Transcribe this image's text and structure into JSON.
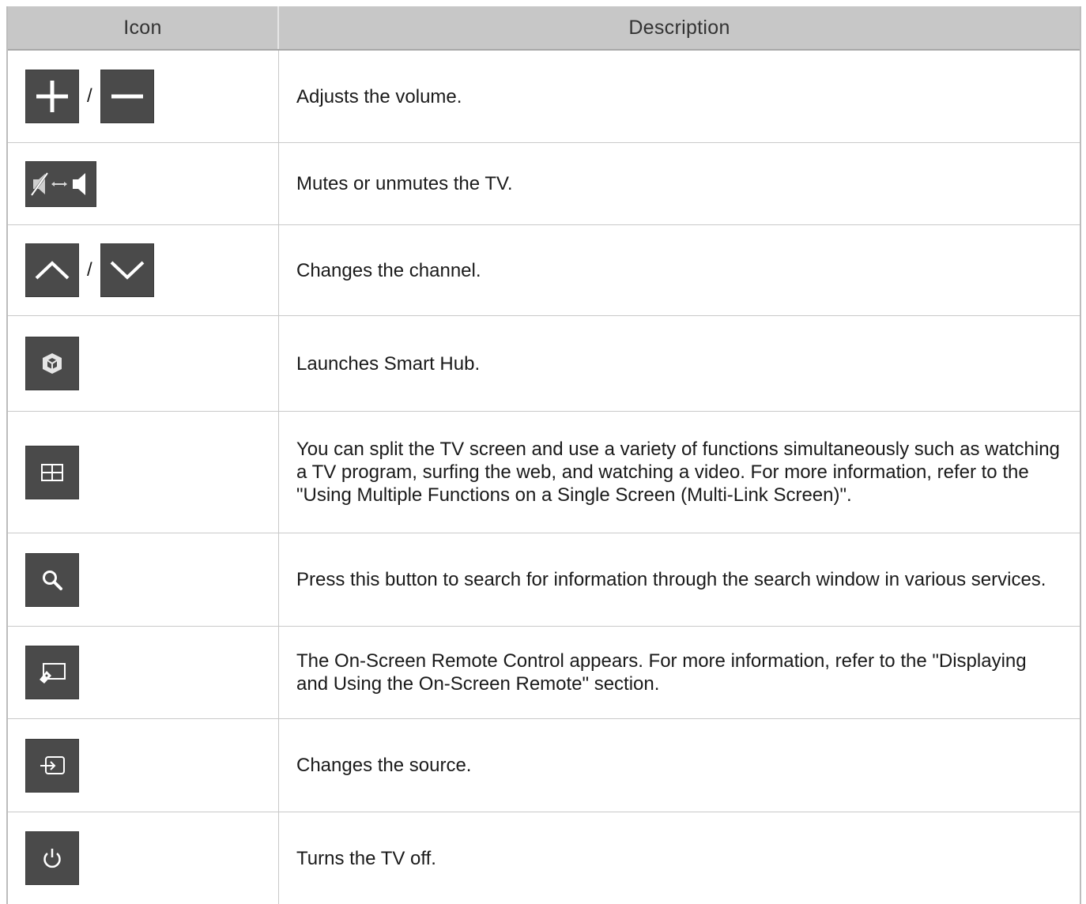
{
  "header": {
    "icon_col": "Icon",
    "description_col": "Description"
  },
  "rows": [
    {
      "icons": [
        "plus-icon",
        "minus-icon"
      ],
      "separator": "/",
      "description": "Adjusts the volume."
    },
    {
      "icons": [
        "mute-toggle-icon"
      ],
      "description": "Mutes or unmutes the TV."
    },
    {
      "icons": [
        "chevron-up-icon",
        "chevron-down-icon"
      ],
      "separator": "/",
      "description": "Changes the channel."
    },
    {
      "icons": [
        "smart-hub-icon"
      ],
      "description": "Launches Smart Hub."
    },
    {
      "icons": [
        "multi-link-screen-icon"
      ],
      "description": "You can split the TV screen and use a variety of functions simultaneously such as watching a TV program, surfing the web, and watching a video. For more information, refer to the \"Using Multiple Functions on a Single Screen (Multi-Link Screen)\"."
    },
    {
      "icons": [
        "search-icon"
      ],
      "description": "Press this button to search for information through the search window in various services."
    },
    {
      "icons": [
        "on-screen-remote-icon"
      ],
      "description": "The On-Screen Remote Control appears. For more information, refer to the \"Displaying and Using the On-Screen Remote\" section."
    },
    {
      "icons": [
        "source-icon"
      ],
      "description": "Changes the source."
    },
    {
      "icons": [
        "power-icon"
      ],
      "description": "Turns the TV off."
    }
  ]
}
